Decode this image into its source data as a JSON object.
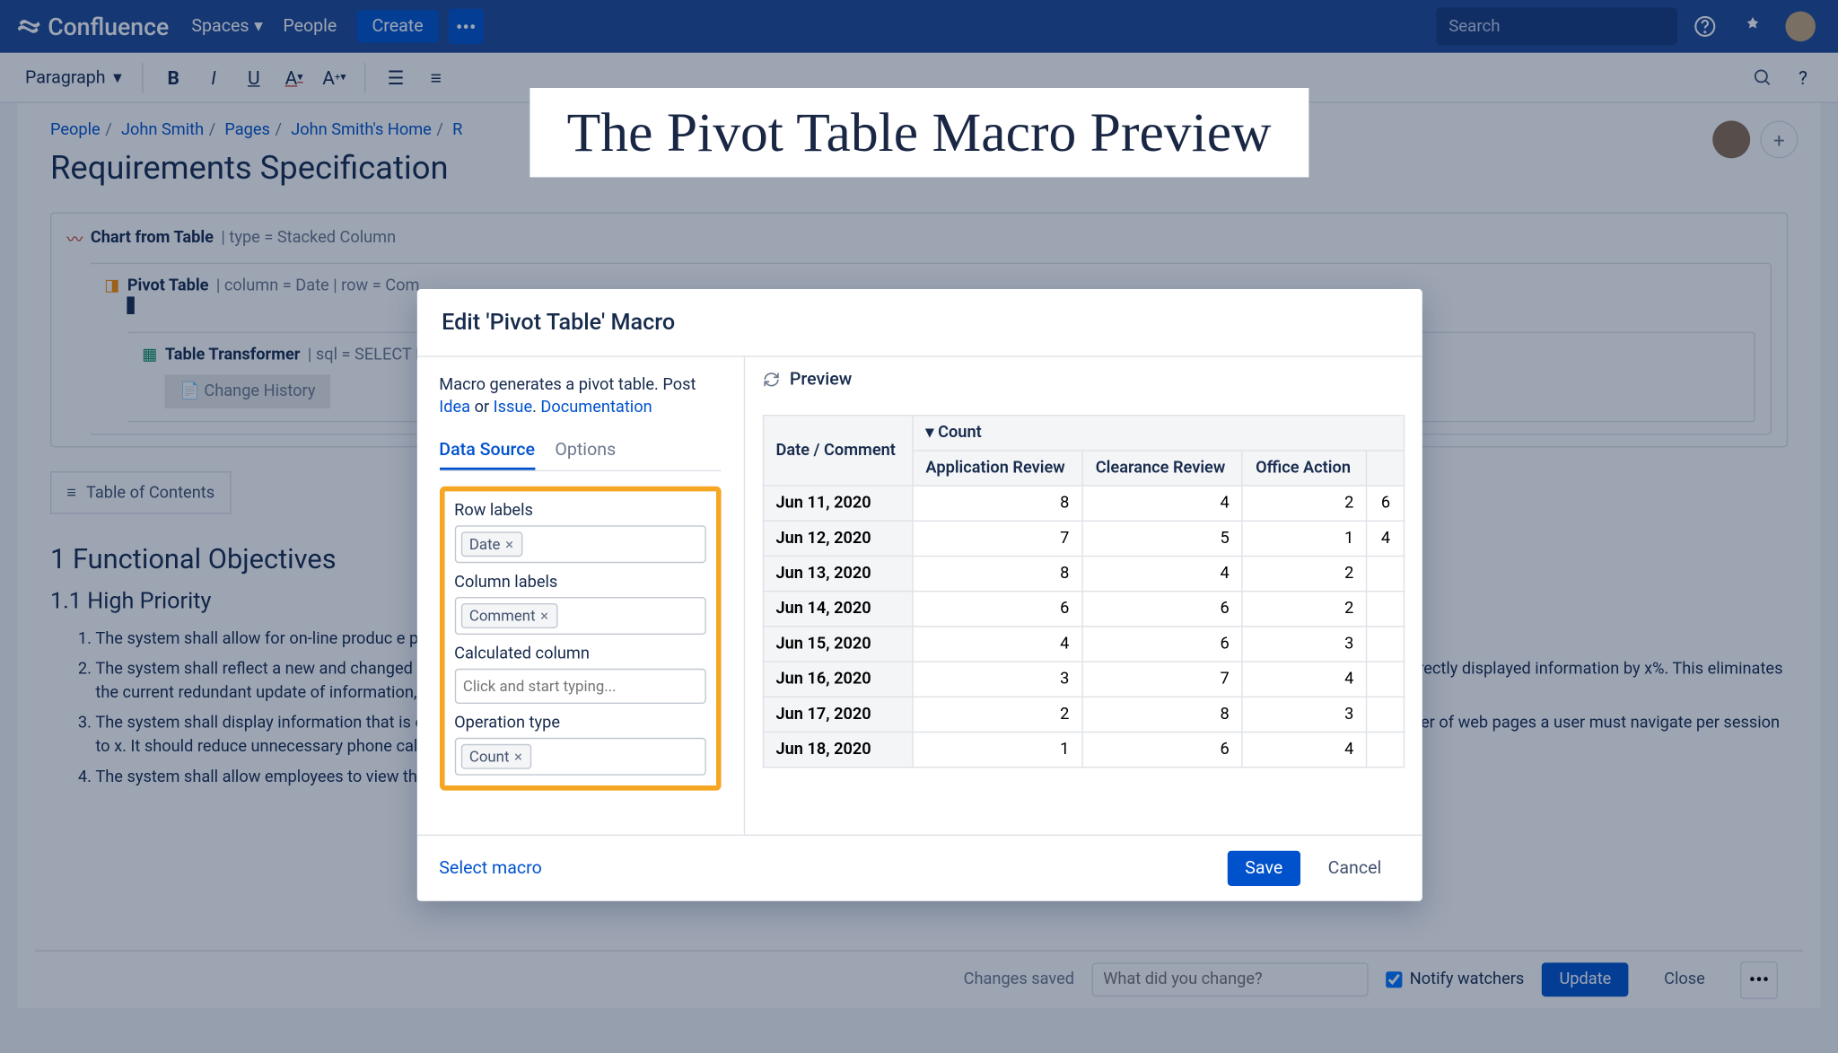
{
  "banner": "The Pivot Table Macro Preview",
  "nav": {
    "product": "Confluence",
    "spaces": "Spaces",
    "people": "People",
    "create": "Create",
    "search_placeholder": "Search"
  },
  "toolbar": {
    "paragraph": "Paragraph"
  },
  "breadcrumb": [
    "People",
    "John Smith",
    "Pages",
    "John Smith's Home",
    "R"
  ],
  "page": {
    "title": "Requirements Specification",
    "macro1": "Chart from Table",
    "macro1_params": "| type = Stacked Column",
    "macro2": "Pivot Table",
    "macro2_params": "| column = Date | row = Com",
    "macro3": "Table Transformer",
    "macro3_params": "| sql = SELECT FOR",
    "macro3_child": "Change History",
    "toc": "Table of Contents",
    "h1": "1 Functional Objectives",
    "h2": "1.1 High Priority",
    "reqs": [
      "The system shall allow for on-line produc                                                                                                                                                                                                                                                                                  e placement of the order. This will reduce the time a sales agent spends on an order by x%. The cost to process an order will be reduced to $y.",
      "The system shall reflect a new and changed product description within x minutes of the database being updated by the product owner. This will reduce the number of incidents of incorrectly displayed information by x%. This eliminates the current redundant update of information, saving $y dollars annually.",
      "The system shall display information that is customized based on the user's company, job function, application and locale. This feature will improve service by reducing the mean number of web pages a user must navigate per session to x. It should reduce unnecessary phone calls to sales agents and staff by x%.",
      "The system shall allow employees to view the owner of any product. An employee should be able to contact the correct owner in one phone call x% of the time."
    ]
  },
  "bottombar": {
    "saved": "Changes saved",
    "placeholder": "What did you change?",
    "notify": "Notify watchers",
    "update": "Update",
    "close": "Close"
  },
  "modal": {
    "title": "Edit 'Pivot Table' Macro",
    "desc1": "Macro generates a pivot table. Post ",
    "link1": "Idea",
    "desc_or": " or ",
    "link2": "Issue",
    "desc_dot": ". ",
    "link3": "Documentation",
    "tab1": "Data Source",
    "tab2": "Options",
    "fields": {
      "row_label": "Row labels",
      "row_tag": "Date",
      "col_label": "Column labels",
      "col_tag": "Comment",
      "calc_label": "Calculated column",
      "calc_placeholder": "Click and start typing...",
      "op_label": "Operation type",
      "op_tag": "Count"
    },
    "preview_label": "Preview",
    "select_macro": "Select macro",
    "save": "Save",
    "cancel": "Cancel",
    "table": {
      "corner": "Date / Comment",
      "count": "Count",
      "cols": [
        "Application Review",
        "Clearance Review",
        "Office Action",
        ""
      ],
      "rows": [
        {
          "d": "Jun 11, 2020",
          "v": [
            "8",
            "4",
            "2",
            "6"
          ]
        },
        {
          "d": "Jun 12, 2020",
          "v": [
            "7",
            "5",
            "1",
            "4"
          ]
        },
        {
          "d": "Jun 13, 2020",
          "v": [
            "8",
            "4",
            "2",
            ""
          ]
        },
        {
          "d": "Jun 14, 2020",
          "v": [
            "6",
            "6",
            "2",
            ""
          ]
        },
        {
          "d": "Jun 15, 2020",
          "v": [
            "4",
            "6",
            "3",
            ""
          ]
        },
        {
          "d": "Jun 16, 2020",
          "v": [
            "3",
            "7",
            "4",
            ""
          ]
        },
        {
          "d": "Jun 17, 2020",
          "v": [
            "2",
            "8",
            "3",
            ""
          ]
        },
        {
          "d": "Jun 18, 2020",
          "v": [
            "1",
            "6",
            "4",
            ""
          ]
        }
      ]
    }
  }
}
